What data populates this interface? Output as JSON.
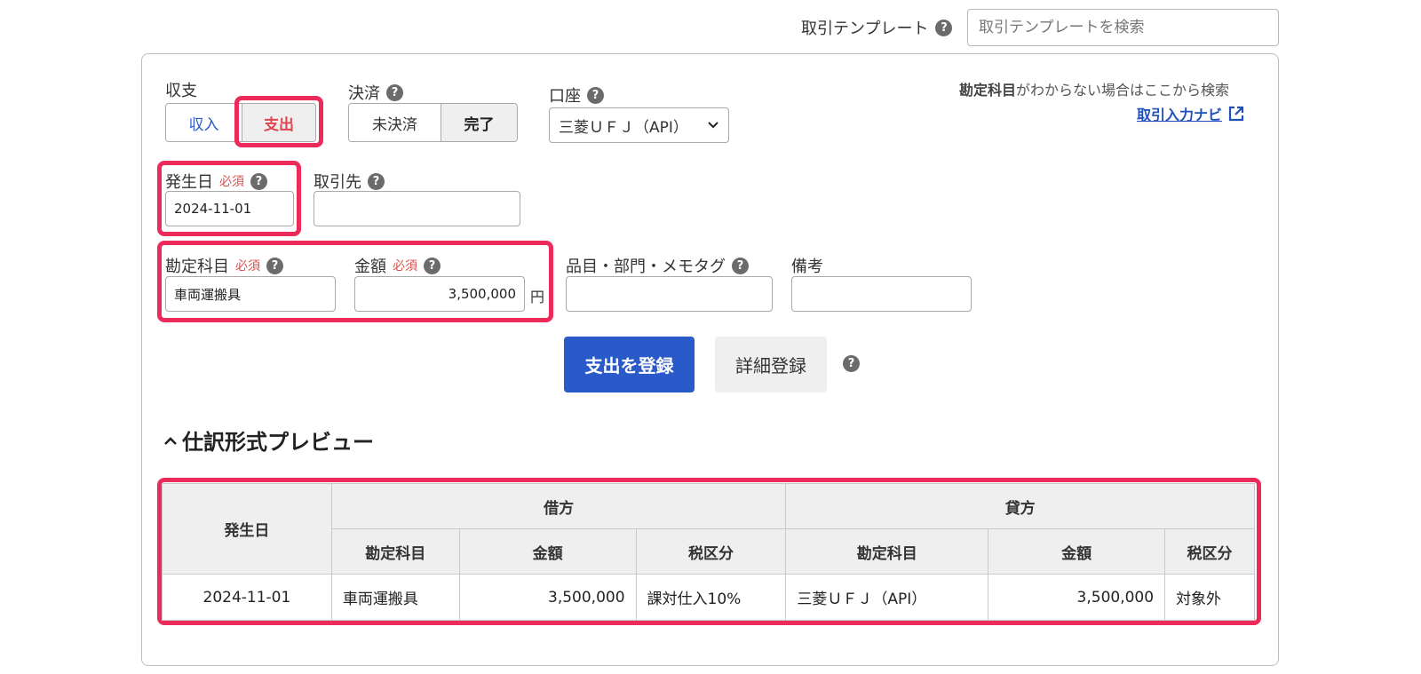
{
  "template": {
    "label": "取引テンプレート",
    "search_placeholder": "取引テンプレートを検索"
  },
  "form": {
    "income_expense": {
      "label": "収支",
      "income": "収入",
      "expense": "支出",
      "selected": "支出"
    },
    "settlement": {
      "label": "決済",
      "unsettled": "未決済",
      "done": "完了",
      "selected": "完了"
    },
    "account": {
      "label": "口座",
      "value": "三菱ＵＦＪ（API）"
    },
    "help_search": {
      "bold": "勘定科目",
      "rest": "がわからない場合はここから検索",
      "link": "取引入力ナビ"
    },
    "date": {
      "label": "発生日",
      "required": "必須",
      "value": "2024-11-01"
    },
    "partner": {
      "label": "取引先",
      "value": ""
    },
    "item_account": {
      "label": "勘定科目",
      "required": "必須",
      "value": "車両運搬具"
    },
    "amount": {
      "label": "金額",
      "required": "必須",
      "value": "3,500,000",
      "unit": "円"
    },
    "tags": {
      "label": "品目・部門・メモタグ",
      "value": ""
    },
    "memo": {
      "label": "備考",
      "value": ""
    },
    "register_button": "支出を登録",
    "detail_button": "詳細登録"
  },
  "preview": {
    "title": "仕訳形式プレビュー",
    "headers": {
      "date": "発生日",
      "debit": "借方",
      "credit": "貸方",
      "account": "勘定科目",
      "amount": "金額",
      "tax": "税区分"
    },
    "row": {
      "date": "2024-11-01",
      "debit_account": "車両運搬具",
      "debit_amount": "3,500,000",
      "debit_tax": "課対仕入10%",
      "credit_account": "三菱ＵＦＪ（API）",
      "credit_amount": "3,500,000",
      "credit_tax": "対象外"
    }
  },
  "colors": {
    "accent_blue": "#2a59c9",
    "highlight": "#ec2b5b",
    "required_red": "#d9534f",
    "expense_red": "#e0454e"
  }
}
